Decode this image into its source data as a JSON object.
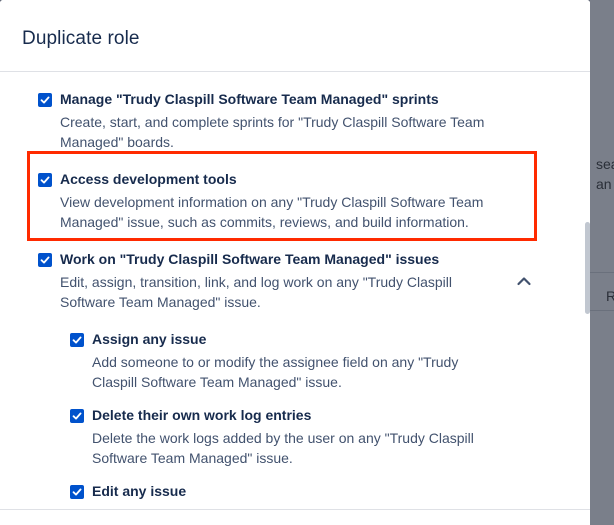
{
  "modal": {
    "title": "Duplicate role"
  },
  "background": {
    "fragments": [
      "sea",
      "an",
      "R"
    ]
  },
  "cut_text": "",
  "permissions": [
    {
      "title": "Manage \"Trudy Claspill Software Team Managed\" sprints",
      "desc_line1": "Create, start, and complete sprints for \"Trudy Claspill Software Team",
      "desc_line2": "Managed\" boards.",
      "checked": true
    },
    {
      "title": "Access development tools",
      "desc_line1": "View development information on any \"Trudy Claspill Software Team",
      "desc_line2": "Managed\" issue, such as commits, reviews, and build information.",
      "checked": true
    },
    {
      "title": "Work on \"Trudy Claspill Software Team Managed\" issues",
      "desc_line1": "Edit, assign, transition, link, and log work on any \"Trudy Claspill",
      "desc_line2": "Software Team Managed\" issue.",
      "checked": true,
      "expanded": true
    },
    {
      "title": "Assign any issue",
      "desc_line1": "Add someone to or modify the assignee field on any \"Trudy",
      "desc_line2": "Claspill Software Team Managed\" issue.",
      "checked": true
    },
    {
      "title": "Delete their own work log entries",
      "desc_line1": "Delete the work logs added by the user on any \"Trudy Claspill",
      "desc_line2": "Software Team Managed\" issue.",
      "checked": true
    },
    {
      "title": "Edit any issue",
      "desc_line1": "",
      "desc_line2": "",
      "checked": true
    }
  ],
  "colors": {
    "checkbox": "#0052cc",
    "highlight": "#ff2a00",
    "title_text": "#172b4d",
    "desc_text": "#42526e"
  }
}
